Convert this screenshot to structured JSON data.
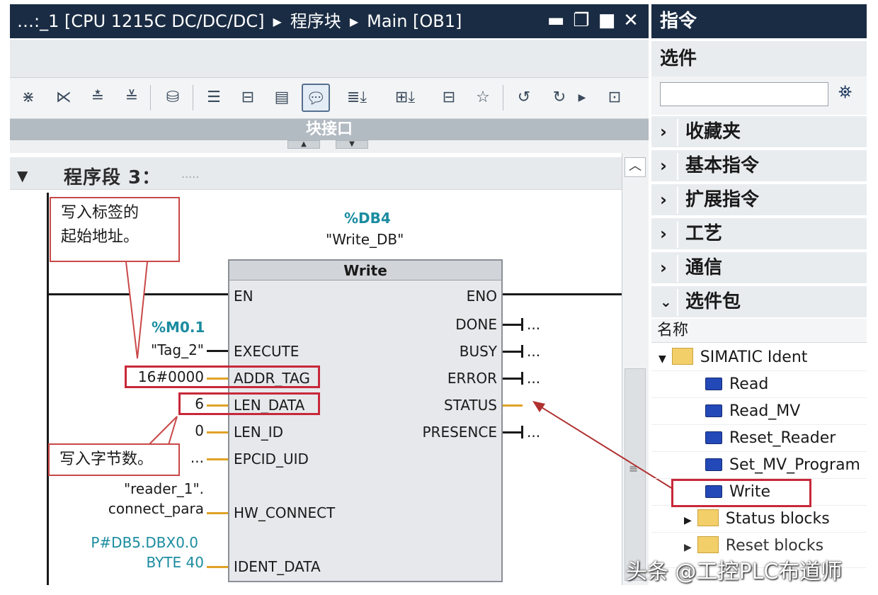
{
  "editor": {
    "breadcrumb": [
      "…:_1 [CPU 1215C DC/DC/DC]",
      "程序块",
      "Main [OB1]"
    ],
    "window_buttons": [
      "minimize-icon",
      "restore-icon",
      "maximize-icon",
      "close-icon"
    ],
    "toolbar_icons": [
      "insert-network-icon",
      "delete-network-icon",
      "insert-row-icon",
      "add-row-icon",
      "block-tags-icon",
      "absolute-operands-icon",
      "favorites-icon",
      "open-all-icon",
      "comments-icon",
      "network-comments-icon",
      "close-all-icon",
      "favorites-bar-icon",
      "empty-box-icon",
      "go-to-prev-error-icon",
      "go-to-next-error-icon",
      "more-icon",
      "monitoring-icon"
    ],
    "block_interface_label": "块接口",
    "network": {
      "title": "程序段 3：",
      "comment": "....."
    }
  },
  "block": {
    "instance_db": "%DB4",
    "instance_db_name": "\"Write_DB\"",
    "type": "Write",
    "inputs": [
      "EN",
      "EXECUTE",
      "ADDR_TAG",
      "LEN_DATA",
      "LEN_ID",
      "EPCID_UID",
      "HW_CONNECT",
      "IDENT_DATA"
    ],
    "outputs": [
      "ENO",
      "DONE",
      "BUSY",
      "ERROR",
      "STATUS",
      "PRESENCE"
    ],
    "output_values": [
      "...",
      "...",
      "...",
      "...",
      "..."
    ],
    "execute_address": "%M0.1",
    "execute_tag": "\"Tag_2\"",
    "addr_tag_value": "16#0000",
    "len_data_value": "6",
    "len_id_value": "0",
    "epcid_value": "...",
    "hw_connect_value_line1": "\"reader_1\".",
    "hw_connect_value_line2": "connect_para",
    "ident_data_value_line1": "P#DB5.DBX0.0",
    "ident_data_value_line2": "BYTE 40"
  },
  "callouts": {
    "addr": [
      "写入标签的",
      "起始地址。"
    ],
    "len": "写入字节数。"
  },
  "panel": {
    "title": "指令",
    "options": "选件",
    "search_placeholder": "",
    "categories": [
      {
        "label": "收藏夹",
        "state": "collapsed"
      },
      {
        "label": "基本指令",
        "state": "collapsed"
      },
      {
        "label": "扩展指令",
        "state": "collapsed"
      },
      {
        "label": "工艺",
        "state": "collapsed"
      },
      {
        "label": "通信",
        "state": "collapsed"
      },
      {
        "label": "选件包",
        "state": "expanded"
      }
    ],
    "column_header": "名称",
    "tree": {
      "folder": "SIMATIC Ident",
      "items": [
        "Read",
        "Read_MV",
        "Reset_Reader",
        "Set_MV_Program",
        "Write"
      ],
      "subfolder": "Status blocks",
      "partial_item": "Reset blocks"
    }
  },
  "watermark": "头条 @工控PLC布道师",
  "colors": {
    "title_bar": "#1a2c43",
    "callout_border": "#c94848",
    "highlight_box": "#c8283a",
    "address_teal": "#1b8ca0",
    "unconnected_orange": "#e0a226",
    "fb_icon_blue": "#2348b8"
  }
}
